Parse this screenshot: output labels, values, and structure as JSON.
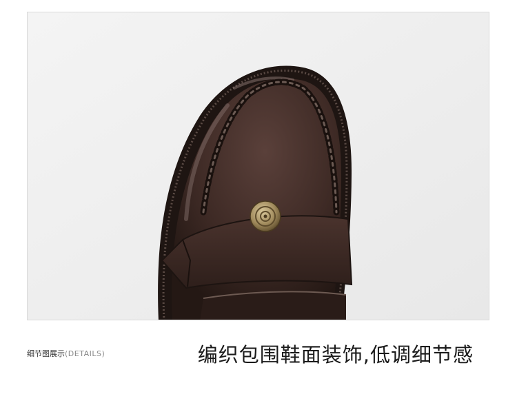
{
  "caption": {
    "section_label_cn": "细节图展示",
    "section_label_en": "(DETAILS)",
    "headline": "编织包围鞋面装饰,低调细节感"
  },
  "photo": {
    "subject_icon": "loafer-shoe-closeup",
    "leather_color": "#3b2723",
    "hardware_color": "#a08a5c",
    "background_color": "#efefef"
  }
}
